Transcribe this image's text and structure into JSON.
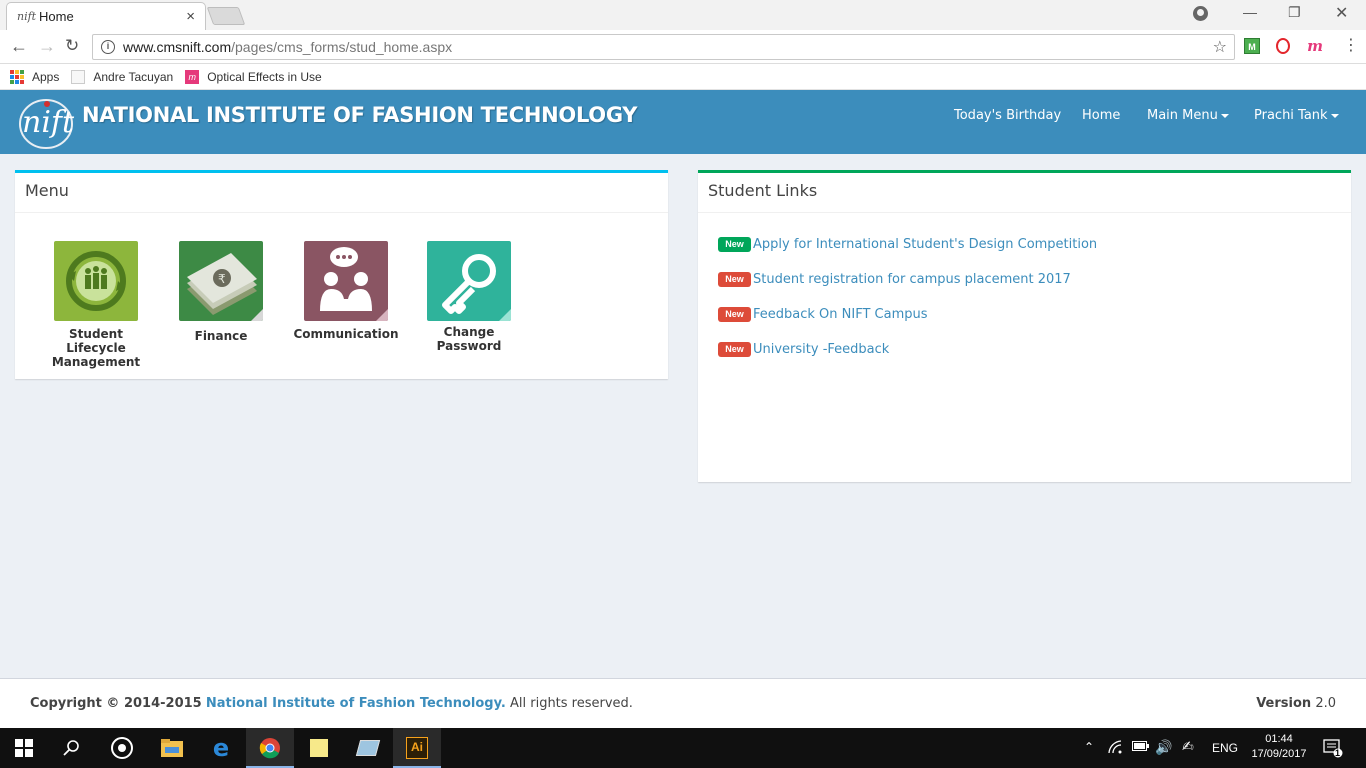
{
  "browser": {
    "tab_title": "Home",
    "tab_close": "×",
    "url_host": "www.cmsnift.com",
    "url_path": "/pages/cms_forms/stud_home.aspx",
    "bookmarks": [
      {
        "label": "Apps"
      },
      {
        "label": "Andre Tacuyan"
      },
      {
        "label": "Optical Effects in Use"
      }
    ]
  },
  "header": {
    "brand": "NATIONAL INSTITUTE OF FASHION TECHNOLOGY",
    "nav": {
      "birthday": "Today's Birthday",
      "home": "Home",
      "main_menu": "Main Menu",
      "user": "Prachi Tank"
    },
    "color": "#3c8dbc"
  },
  "menu_box": {
    "title": "Menu",
    "accent": "#00c0ef",
    "items": [
      {
        "label_line1": "Student Lifecycle",
        "label_line2": "Management",
        "color": "#8db63c"
      },
      {
        "label_line1": "Finance",
        "label_line2": "",
        "color": "#3d8a45"
      },
      {
        "label_line1": "Communication",
        "label_line2": "",
        "color": "#8a5563"
      },
      {
        "label_line1": "Change",
        "label_line2": "Password",
        "color": "#2fb39b"
      }
    ]
  },
  "links_box": {
    "title": "Student Links",
    "accent": "#00a65a",
    "links": [
      {
        "badge": "New",
        "badge_color": "#00a65a",
        "text": "Apply for International Student's Design Competition"
      },
      {
        "badge": "New",
        "badge_color": "#dd4b39",
        "text": "Student registration for campus placement 2017"
      },
      {
        "badge": "New",
        "badge_color": "#dd4b39",
        "text": "Feedback On NIFT Campus"
      },
      {
        "badge": "New",
        "badge_color": "#dd4b39",
        "text": "University -Feedback"
      }
    ]
  },
  "footer": {
    "copyright": "Copyright © 2014-2015",
    "org": "National Institute of Fashion Technology.",
    "rights": "All rights reserved.",
    "version_label": "Version",
    "version": "2.0"
  },
  "taskbar": {
    "language": "ENG",
    "time": "01:44",
    "date": "17/09/2017",
    "notification_count": "1"
  }
}
